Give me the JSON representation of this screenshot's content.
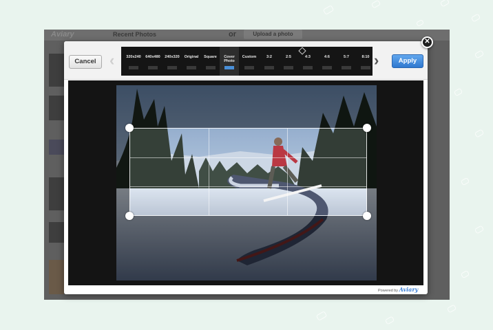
{
  "background_app": {
    "logo": "Aviary",
    "title": "Recent Photos",
    "or_text": "or",
    "upload_label": "Upload a photo"
  },
  "toolbar": {
    "cancel_label": "Cancel",
    "apply_label": "Apply",
    "prev_icon": "chevron-left-icon",
    "next_icon": "chevron-right-icon",
    "aspect_ratios": [
      {
        "label": "320x240",
        "active": false
      },
      {
        "label": "640x480",
        "active": false
      },
      {
        "label": "240x320",
        "active": false
      },
      {
        "label": "Original",
        "active": false
      },
      {
        "label": "Square",
        "active": false
      },
      {
        "label": "Cover\nPhoto",
        "active": true
      },
      {
        "label": "Custom",
        "active": false
      },
      {
        "label": "3:2",
        "active": false
      },
      {
        "label": "2:5",
        "active": false
      },
      {
        "label": "4:3",
        "active": false
      },
      {
        "label": "4:6",
        "active": false
      },
      {
        "label": "5:7",
        "active": false
      },
      {
        "label": "8:10",
        "active": false
      }
    ]
  },
  "footer": {
    "powered_by": "Powered by",
    "brand": "Aviary"
  },
  "colors": {
    "apply": "#3a86e0",
    "active_ratio": "#4a90d9",
    "canvas": "#141414",
    "page_bg": "#e9f4ee"
  }
}
